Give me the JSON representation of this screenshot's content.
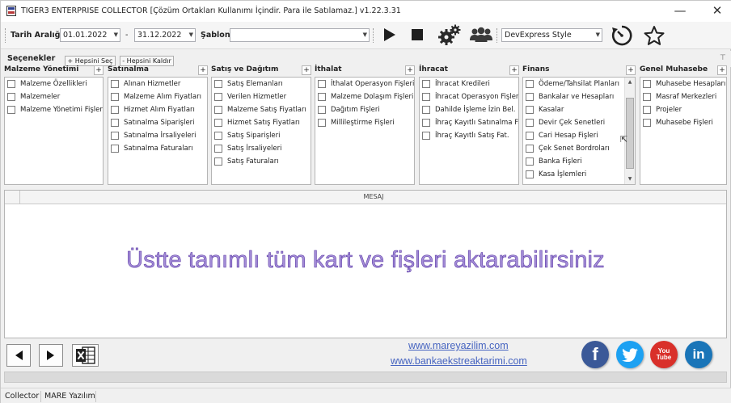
{
  "window": {
    "title": "TIGER3 ENTERPRISE COLLECTOR [Çözüm Ortakları Kullanımı İçindir. Para ile Satılamaz.]  v1.22.3.31",
    "minimize": "—",
    "close": "✕"
  },
  "toolbar": {
    "date_range_label": "Tarih Aralığı",
    "date_from": "01.01.2022",
    "date_sep": "-",
    "date_to": "31.12.2022",
    "template_label": "Şablon",
    "template_value": "",
    "style_value": "DevExpress Style",
    "icons": [
      "play-icon",
      "stop-icon",
      "gears-icon",
      "users-icon",
      "timer-icon",
      "star-icon"
    ]
  },
  "options": {
    "title": "Seçenekler",
    "select_all": "+ Hepsini Seç",
    "clear_all": "- Hepsini Kaldır"
  },
  "panels": [
    {
      "title": "Malzeme Yönetimi",
      "items": [
        "Malzeme Özellikleri",
        "Malzemeler",
        "Malzeme Yönetimi Fişleri"
      ]
    },
    {
      "title": "Satınalma",
      "items": [
        "Alınan Hizmetler",
        "Malzeme Alım Fiyatları",
        "Hizmet Alım Fiyatları",
        "Satınalma Siparişleri",
        "Satınalma İrsaliyeleri",
        "Satınalma Faturaları"
      ]
    },
    {
      "title": "Satış ve Dağıtım",
      "items": [
        "Satış Elemanları",
        "Verilen Hizmetler",
        "Malzeme Satış Fiyatları",
        "Hizmet Satış Fiyatları",
        "Satış Siparişleri",
        "Satış İrsaliyeleri",
        "Satış Faturaları"
      ]
    },
    {
      "title": "İthalat",
      "items": [
        "İthalat Operasyon Fişleri",
        "Malzeme Dolaşım Fişleri",
        "Dağıtım Fişleri",
        "Millileştirme Fişleri"
      ]
    },
    {
      "title": "İhracat",
      "items": [
        "İhracat Kredileri",
        "İhracat Operasyon Fişleri",
        "Dahilde İşleme İzin Bel.",
        "İhraç Kayıtlı Satınalma Fa",
        "İhraç Kayıtlı Satış Fat."
      ]
    },
    {
      "title": "Finans",
      "items": [
        "Ödeme/Tahsilat Planları",
        "Bankalar ve Hesapları",
        "Kasalar",
        "Devir Çek Senetleri",
        "Cari Hesap Fişleri",
        "Çek Senet Bordroları",
        "Banka Fişleri",
        "Kasa İşlemleri"
      ]
    },
    {
      "title": "Genel Muhasebe",
      "items": [
        "Muhasebe Hesapları",
        "Masraf Merkezleri",
        "Projeler",
        "Muhasebe Fişleri"
      ]
    }
  ],
  "panel_add_label": "+",
  "message_grid": {
    "column": "MESAJ",
    "overlay": "Üstte tanımlı tüm kart ve fişleri aktarabilirsiniz"
  },
  "links": {
    "site1": "www.mareyazilim.com",
    "site2": "www.bankaekstreaktarimi.com"
  },
  "social": [
    {
      "name": "facebook",
      "label": "f",
      "color": "#3b5998"
    },
    {
      "name": "twitter",
      "label": "t",
      "color": "#1da1f2"
    },
    {
      "name": "youtube",
      "label": "You Tube",
      "color": "#d9302a"
    },
    {
      "name": "linkedin",
      "label": "in",
      "color": "#1a75b8"
    }
  ],
  "status": {
    "left": "Collector",
    "right": "MARE Yazılım"
  }
}
